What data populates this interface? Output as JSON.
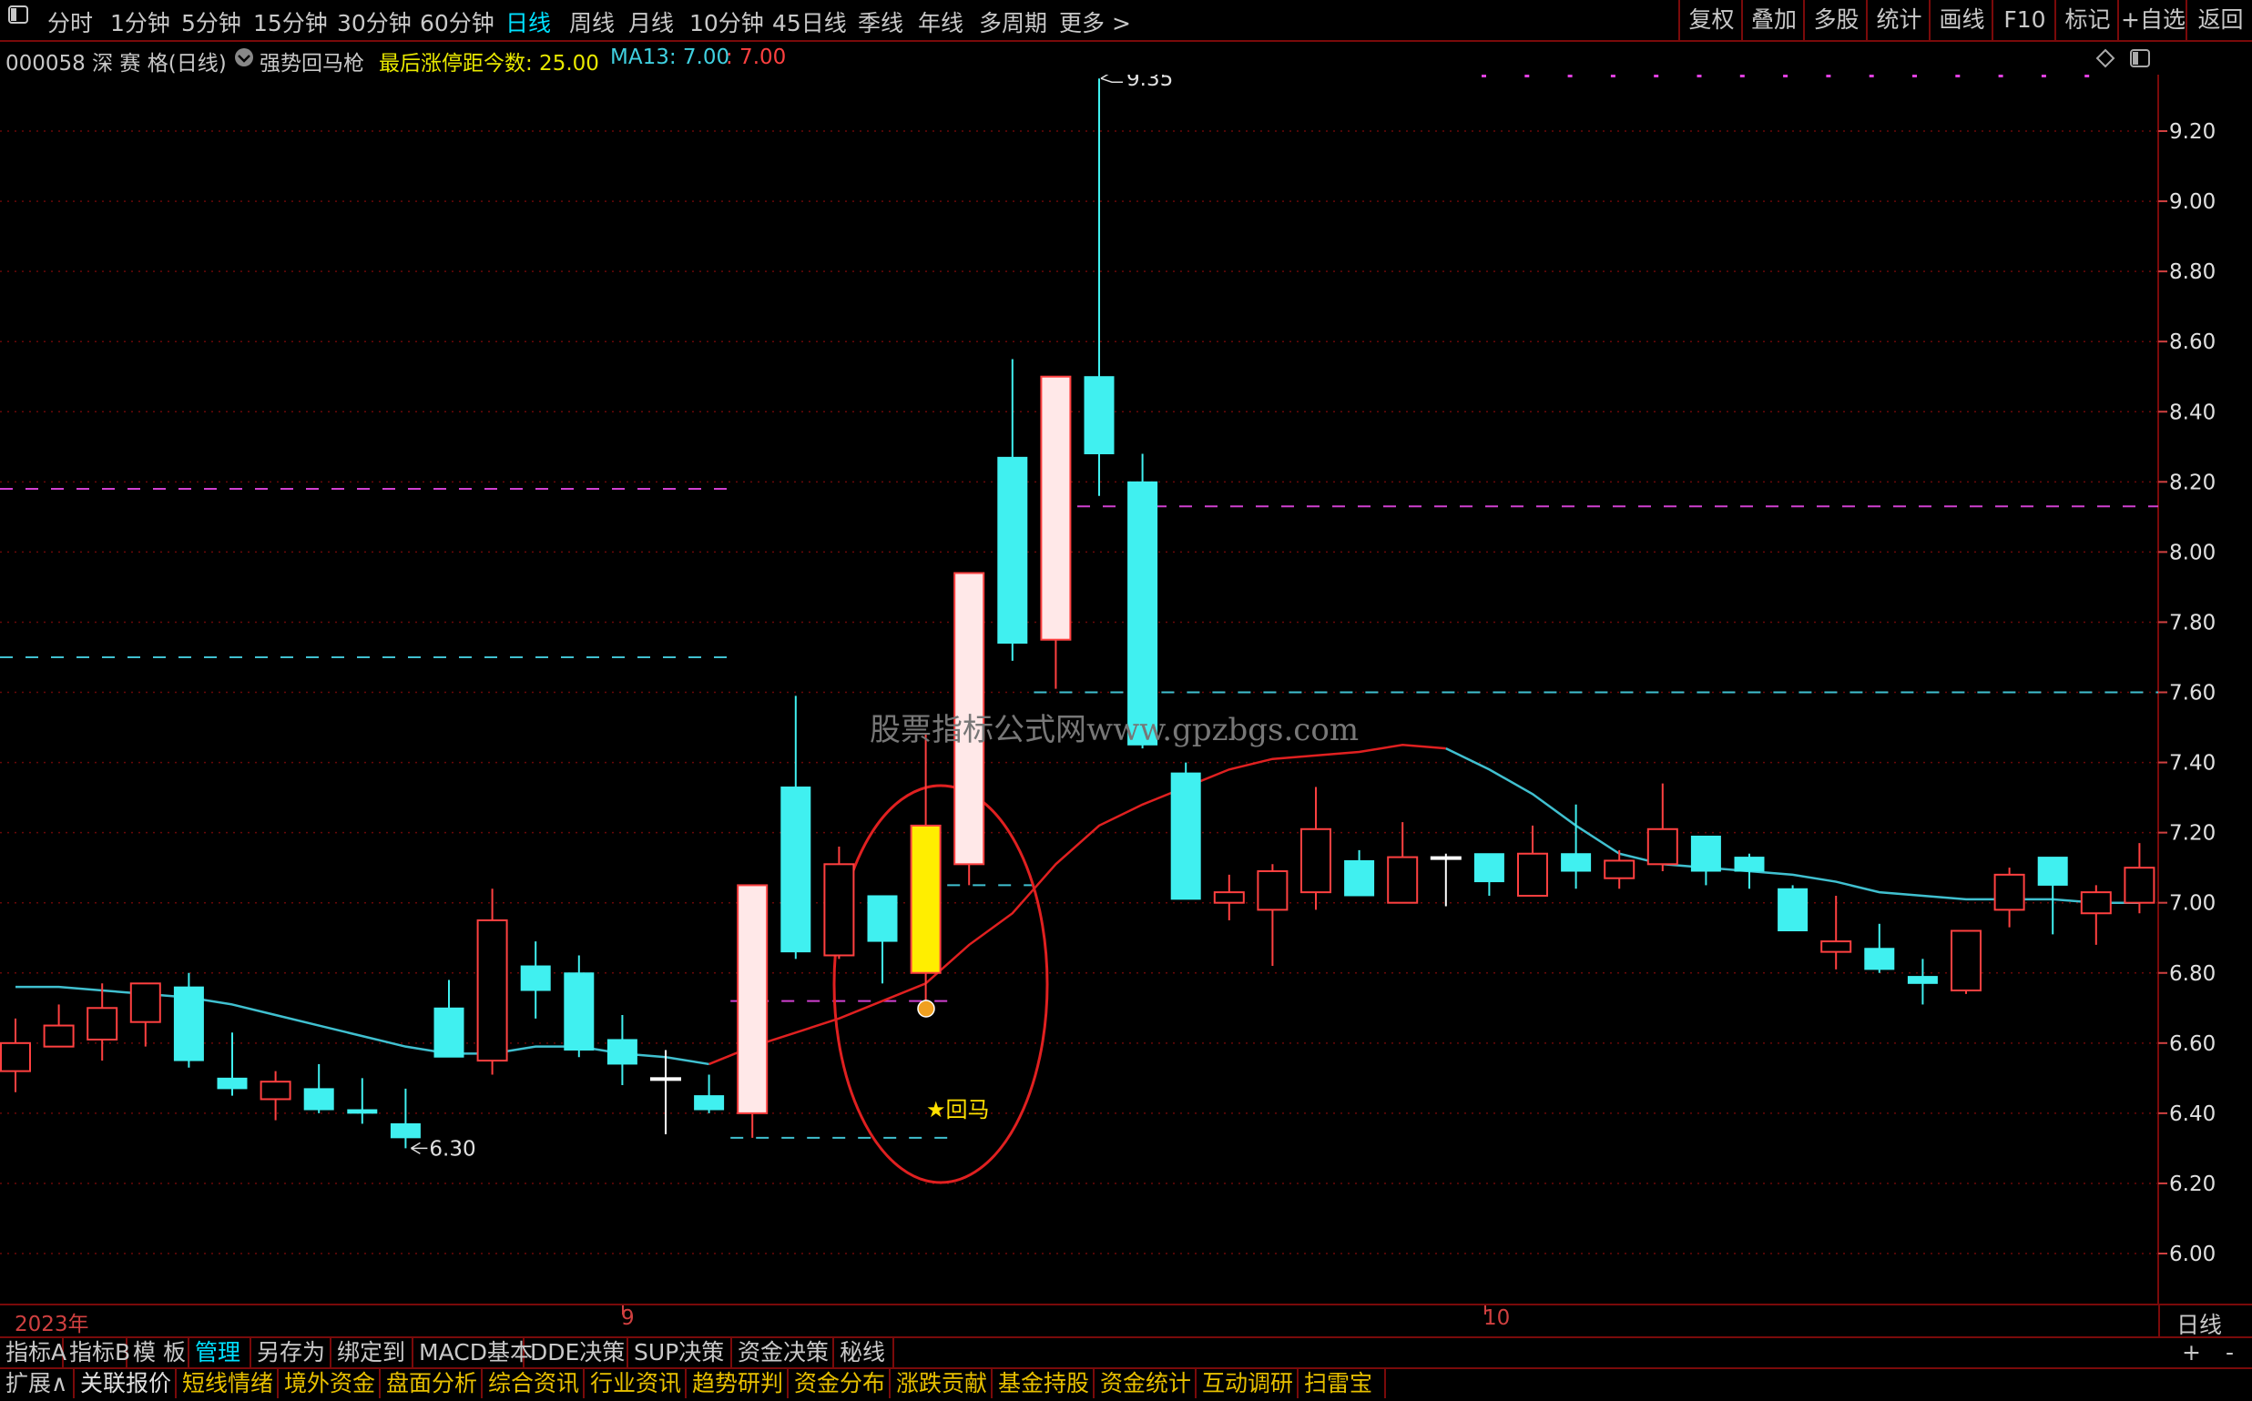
{
  "toolbar": {
    "window_icon": "window-icon",
    "periods": [
      "分时",
      "1分钟",
      "5分钟",
      "15分钟",
      "30分钟",
      "60分钟",
      "日线",
      "周线",
      "月线",
      "10分钟",
      "45日线",
      "季线",
      "年线",
      "多周期",
      "更多 >"
    ],
    "active_period": "日线",
    "right_buttons": [
      "复权",
      "叠加",
      "多股",
      "统计",
      "画线",
      "F10",
      "标记",
      "+自选",
      "返回"
    ]
  },
  "info": {
    "title": "000058 深 赛 格(日线)",
    "indicator_name": "强势回马枪",
    "limit_label": "最后涨停距今数: 25.00",
    "ma_label": "MA13: 7.00",
    "value_label": ": 7.00"
  },
  "chart_data": {
    "type": "candlestick",
    "title": "000058 深 赛 格(日线)",
    "ylim": [
      5.9,
      9.45
    ],
    "yticks": [
      "9.20",
      "9.00",
      "8.80",
      "8.60",
      "8.40",
      "8.20",
      "8.00",
      "7.80",
      "7.60",
      "7.40",
      "7.20",
      "7.00",
      "6.80",
      "6.60",
      "6.40",
      "6.20",
      "6.00"
    ],
    "candles": [
      {
        "o": 6.52,
        "c": 6.6,
        "h": 6.67,
        "l": 6.46
      },
      {
        "o": 6.59,
        "c": 6.65,
        "h": 6.71,
        "l": 6.59
      },
      {
        "o": 6.61,
        "c": 6.7,
        "h": 6.77,
        "l": 6.55
      },
      {
        "o": 6.66,
        "c": 6.77,
        "h": 6.77,
        "l": 6.59
      },
      {
        "o": 6.76,
        "c": 6.55,
        "h": 6.8,
        "l": 6.53
      },
      {
        "o": 6.5,
        "c": 6.47,
        "h": 6.63,
        "l": 6.45
      },
      {
        "o": 6.44,
        "c": 6.49,
        "h": 6.52,
        "l": 6.38
      },
      {
        "o": 6.47,
        "c": 6.41,
        "h": 6.54,
        "l": 6.4
      },
      {
        "o": 6.41,
        "c": 6.4,
        "h": 6.5,
        "l": 6.37
      },
      {
        "o": 6.37,
        "c": 6.33,
        "h": 6.47,
        "l": 6.3
      },
      {
        "o": 6.7,
        "c": 6.56,
        "h": 6.78,
        "l": 6.56
      },
      {
        "o": 6.55,
        "c": 6.95,
        "h": 7.04,
        "l": 6.51
      },
      {
        "o": 6.82,
        "c": 6.75,
        "h": 6.89,
        "l": 6.67
      },
      {
        "o": 6.8,
        "c": 6.58,
        "h": 6.85,
        "l": 6.56
      },
      {
        "o": 6.61,
        "c": 6.54,
        "h": 6.68,
        "l": 6.48
      },
      {
        "o": 6.5,
        "c": 6.5,
        "h": 6.58,
        "l": 6.34
      },
      {
        "o": 6.45,
        "c": 6.41,
        "h": 6.51,
        "l": 6.4
      },
      {
        "o": 6.4,
        "c": 7.05,
        "h": 7.05,
        "l": 6.33
      },
      {
        "o": 7.33,
        "c": 6.86,
        "h": 7.59,
        "l": 6.84
      },
      {
        "o": 6.85,
        "c": 7.11,
        "h": 7.16,
        "l": 6.84
      },
      {
        "o": 7.02,
        "c": 6.89,
        "h": 7.02,
        "l": 6.77
      },
      {
        "o": 6.8,
        "c": 7.22,
        "h": 7.48,
        "l": 6.72,
        "highlight": true
      },
      {
        "o": 7.11,
        "c": 7.94,
        "h": 7.94,
        "l": 7.05
      },
      {
        "o": 8.27,
        "c": 7.74,
        "h": 8.55,
        "l": 7.69
      },
      {
        "o": 7.75,
        "c": 8.5,
        "h": 8.5,
        "l": 7.61
      },
      {
        "o": 8.5,
        "c": 8.28,
        "h": 9.35,
        "l": 8.16
      },
      {
        "o": 8.2,
        "c": 7.45,
        "h": 8.28,
        "l": 7.44
      },
      {
        "o": 7.37,
        "c": 7.01,
        "h": 7.4,
        "l": 7.01
      },
      {
        "o": 7.0,
        "c": 7.03,
        "h": 7.08,
        "l": 6.95
      },
      {
        "o": 6.98,
        "c": 7.09,
        "h": 7.11,
        "l": 6.82
      },
      {
        "o": 7.03,
        "c": 7.21,
        "h": 7.33,
        "l": 6.98
      },
      {
        "o": 7.12,
        "c": 7.02,
        "h": 7.15,
        "l": 7.02
      },
      {
        "o": 7.0,
        "c": 7.13,
        "h": 7.23,
        "l": 7.0
      },
      {
        "o": 7.13,
        "c": 7.13,
        "h": 7.14,
        "l": 6.99
      },
      {
        "o": 7.14,
        "c": 7.06,
        "h": 7.14,
        "l": 7.02
      },
      {
        "o": 7.02,
        "c": 7.14,
        "h": 7.22,
        "l": 7.02
      },
      {
        "o": 7.14,
        "c": 7.09,
        "h": 7.28,
        "l": 7.04
      },
      {
        "o": 7.07,
        "c": 7.12,
        "h": 7.15,
        "l": 7.04
      },
      {
        "o": 7.11,
        "c": 7.21,
        "h": 7.34,
        "l": 7.09
      },
      {
        "o": 7.19,
        "c": 7.09,
        "h": 7.19,
        "l": 7.05
      },
      {
        "o": 7.13,
        "c": 7.09,
        "h": 7.14,
        "l": 7.04
      },
      {
        "o": 7.04,
        "c": 6.92,
        "h": 7.05,
        "l": 6.92
      },
      {
        "o": 6.86,
        "c": 6.89,
        "h": 7.02,
        "l": 6.81
      },
      {
        "o": 6.87,
        "c": 6.81,
        "h": 6.94,
        "l": 6.8
      },
      {
        "o": 6.79,
        "c": 6.77,
        "h": 6.84,
        "l": 6.71
      },
      {
        "o": 6.75,
        "c": 6.92,
        "h": 6.92,
        "l": 6.74
      },
      {
        "o": 6.98,
        "c": 7.08,
        "h": 7.1,
        "l": 6.93
      },
      {
        "o": 7.13,
        "c": 7.05,
        "h": 7.13,
        "l": 6.91
      },
      {
        "o": 6.97,
        "c": 7.03,
        "h": 7.05,
        "l": 6.88
      },
      {
        "o": 7.0,
        "c": 7.1,
        "h": 7.17,
        "l": 6.97
      }
    ],
    "ma13": [
      6.76,
      6.76,
      6.75,
      6.74,
      6.73,
      6.71,
      6.68,
      6.65,
      6.62,
      6.59,
      6.57,
      6.57,
      6.59,
      6.59,
      6.57,
      6.56,
      6.54,
      6.59,
      6.63,
      6.67,
      6.72,
      6.77,
      6.88,
      6.97,
      7.11,
      7.22,
      7.28,
      7.33,
      7.38,
      7.41,
      7.42,
      7.43,
      7.45,
      7.44,
      7.38,
      7.31,
      7.22,
      7.14,
      7.11,
      7.1,
      7.09,
      7.08,
      7.06,
      7.03,
      7.02,
      7.01,
      7.01,
      7.01,
      7.0,
      7.0
    ],
    "annotations": {
      "high_label": "9.35",
      "low_label": "6.30",
      "signal_label": "★回马"
    },
    "hlines": [
      {
        "y": 8.18,
        "color": "#d040d0",
        "from": 0,
        "to": 16
      },
      {
        "y": 7.7,
        "color": "#40c0d0",
        "from": 0,
        "to": 16
      },
      {
        "y": 8.13,
        "color": "#d040d0",
        "from": 25,
        "to": 49
      },
      {
        "y": 7.6,
        "color": "#40c0d0",
        "from": 24,
        "to": 49
      },
      {
        "y": 6.72,
        "color": "#d040d0",
        "from": 17,
        "to": 21
      },
      {
        "y": 6.33,
        "color": "#40c0d0",
        "from": 17,
        "to": 21
      },
      {
        "y": 7.05,
        "color": "#40c0d0",
        "from": 22,
        "to": 23
      }
    ],
    "dates": [
      "2023年",
      "9",
      "10"
    ],
    "period_label": "日线"
  },
  "watermark": "股票指标公式网www.gpzbgs.com",
  "tabs_row1": [
    "指标A",
    "指标B",
    "模 板",
    "管理",
    "另存为",
    "绑定到",
    "MACD基本",
    "DDE决策",
    "SUP决策",
    "资金决策",
    "秘线"
  ],
  "tabs_row1_active": "管理",
  "tabs_row1_controls": [
    "+",
    "-"
  ],
  "tabs_row2": [
    "扩展∧",
    "关联报价",
    "短线情绪",
    "境外资金",
    "盘面分析",
    "综合资讯",
    "行业资讯",
    "趋势研判",
    "资金分布",
    "涨跌贡献",
    "基金持股",
    "资金统计",
    "互动调研",
    "扫雷宝"
  ],
  "colors": {
    "up": "#ff4040",
    "down": "#40f0f0",
    "highlight": "#ffee00",
    "ma": "#40c0d0",
    "grid": "#7a0a0a"
  }
}
